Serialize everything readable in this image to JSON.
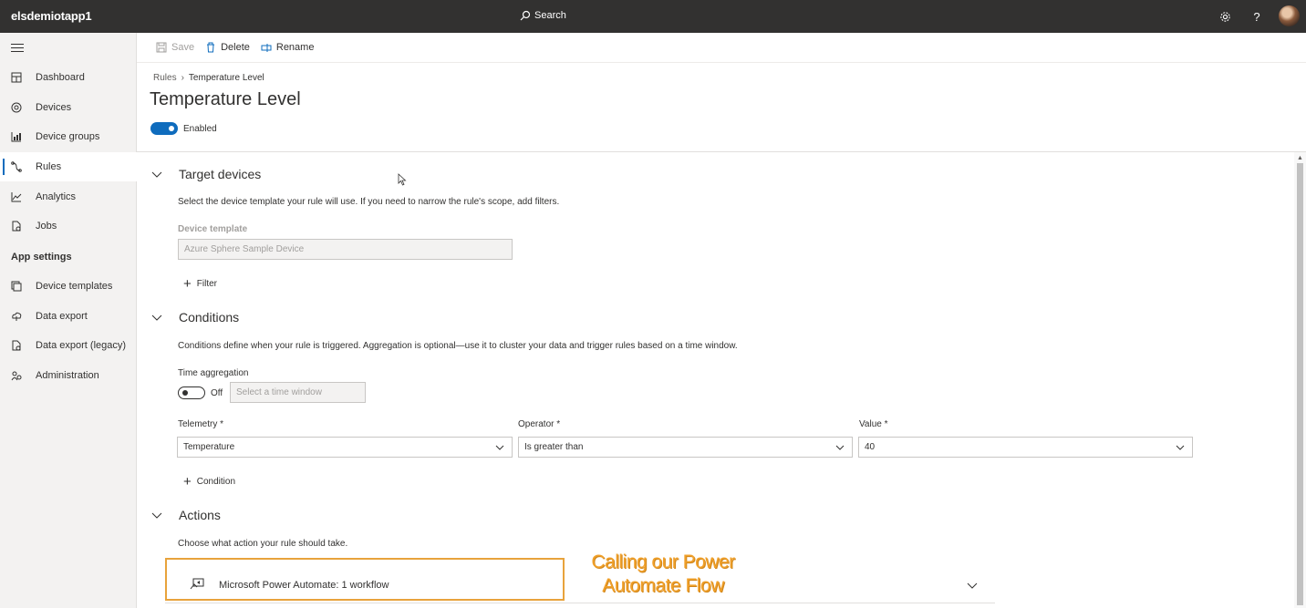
{
  "app": {
    "name": "elsdemiotapp1"
  },
  "topbar": {
    "search_label": "Search",
    "settings_icon": "gear-icon",
    "help_icon": "?",
    "avatar": "user-avatar"
  },
  "nav": {
    "items": [
      {
        "label": "Dashboard",
        "icon": "dashboard-icon"
      },
      {
        "label": "Devices",
        "icon": "devices-icon"
      },
      {
        "label": "Device groups",
        "icon": "device-groups-icon"
      },
      {
        "label": "Rules",
        "icon": "rules-icon",
        "active": true
      },
      {
        "label": "Analytics",
        "icon": "analytics-icon"
      },
      {
        "label": "Jobs",
        "icon": "jobs-icon"
      }
    ],
    "section_label": "App settings",
    "settings_items": [
      {
        "label": "Device templates",
        "icon": "device-templates-icon"
      },
      {
        "label": "Data export",
        "icon": "data-export-icon"
      },
      {
        "label": "Data export (legacy)",
        "icon": "data-export-legacy-icon"
      },
      {
        "label": "Administration",
        "icon": "administration-icon"
      }
    ]
  },
  "commands": {
    "save": "Save",
    "delete": "Delete",
    "rename": "Rename"
  },
  "breadcrumb": {
    "parent": "Rules",
    "current": "Temperature Level"
  },
  "page": {
    "title": "Temperature Level",
    "enabled_label": "Enabled"
  },
  "target_devices": {
    "title": "Target devices",
    "description": "Select the device template your rule will use. If you need to narrow the rule's scope, add filters.",
    "template_label": "Device template",
    "template_value": "Azure Sphere Sample Device",
    "filter_label": "Filter"
  },
  "conditions": {
    "title": "Conditions",
    "description": "Conditions define when your rule is triggered. Aggregation is optional—use it to cluster your data and trigger rules based on a time window.",
    "time_aggregation_label": "Time aggregation",
    "toggle_state": "Off",
    "time_window_placeholder": "Select a time window",
    "telemetry_label": "Telemetry *",
    "telemetry_value": "Temperature",
    "operator_label": "Operator *",
    "operator_value": "Is greater than",
    "value_label": "Value *",
    "value_value": "40",
    "add_condition_label": "Condition"
  },
  "actions": {
    "title": "Actions",
    "description": "Choose what action your rule should take.",
    "item_label": "Microsoft Power Automate: 1 workflow"
  },
  "annotation": {
    "line1": "Calling our Power",
    "line2": "Automate Flow"
  },
  "colors": {
    "accent": "#0f6cbd",
    "annotation": "#f0a02a",
    "topbar": "#323130"
  }
}
